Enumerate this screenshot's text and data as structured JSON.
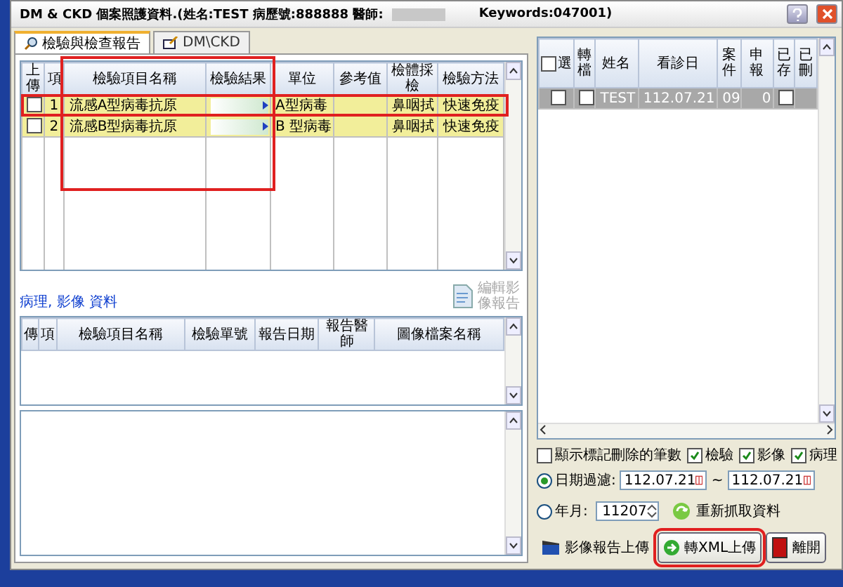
{
  "window": {
    "title": "DM & CKD 個案照護資料.(姓名:TEST 病歷號:888888 醫師:",
    "title_suffix": "Keywords:047001)"
  },
  "tabs": [
    {
      "label": "檢驗與檢查報告",
      "selected": true
    },
    {
      "label": "DM\\CKD",
      "selected": false
    }
  ],
  "lab_grid": {
    "column_frame": true,
    "columns": [
      "上傳",
      "項",
      "檢驗項目名稱",
      "檢驗結果",
      "單位",
      "參考值",
      "檢體採檢",
      "檢驗方法"
    ],
    "rows": [
      {
        "upload": false,
        "index": "1",
        "name": "流感A型病毒抗原",
        "unit": "A型病毒",
        "reference": "",
        "specimen": "鼻咽拭",
        "method": "快速免疫",
        "highlighted": true
      },
      {
        "upload": false,
        "index": "2",
        "name": "流感B型病毒抗原",
        "unit": "B 型病毒",
        "reference": "",
        "specimen": "鼻咽拭",
        "method": "快速免疫",
        "highlighted": false
      }
    ]
  },
  "image_section": {
    "title": "病理, 影像 資料",
    "edit_button": {
      "label": "編輯影像報告",
      "disabled": true
    },
    "columns": [
      "傳",
      "項",
      "檢驗項目名稱",
      "檢驗單號",
      "報告日期",
      "報告醫師",
      "圖像檔案名稱"
    ]
  },
  "patient_grid": {
    "select_all": false,
    "columns": [
      "選",
      "轉檔",
      "姓名",
      "看診日",
      "案件",
      "申報",
      "已存",
      "已刪"
    ],
    "rows": [
      {
        "selected": true,
        "checked": false,
        "converted": false,
        "name": "TEST",
        "visit_date": "112.07.21",
        "case": "09",
        "claim": "0",
        "saved": false
      }
    ]
  },
  "options": {
    "show_deleted": {
      "label": "顯示標記刪除的筆數",
      "checked": false
    },
    "filters": [
      {
        "label": "檢驗",
        "checked": true
      },
      {
        "label": "影像",
        "checked": true
      },
      {
        "label": "病理",
        "checked": true
      }
    ],
    "date_filter": {
      "label": "日期過濾:",
      "selected": true,
      "from": "112.07.21",
      "separator": "~",
      "to": "112.07.21"
    },
    "month_filter": {
      "label": "年月:",
      "selected": false,
      "value": "11207"
    },
    "refresh": "重新抓取資料"
  },
  "buttons": [
    {
      "kind": "upload",
      "label": "影像報告上傳",
      "highlighted": false
    },
    {
      "kind": "xml",
      "label": "轉XML上傳",
      "highlighted": true
    },
    {
      "kind": "exit",
      "label": "離開",
      "highlighted": false
    }
  ]
}
